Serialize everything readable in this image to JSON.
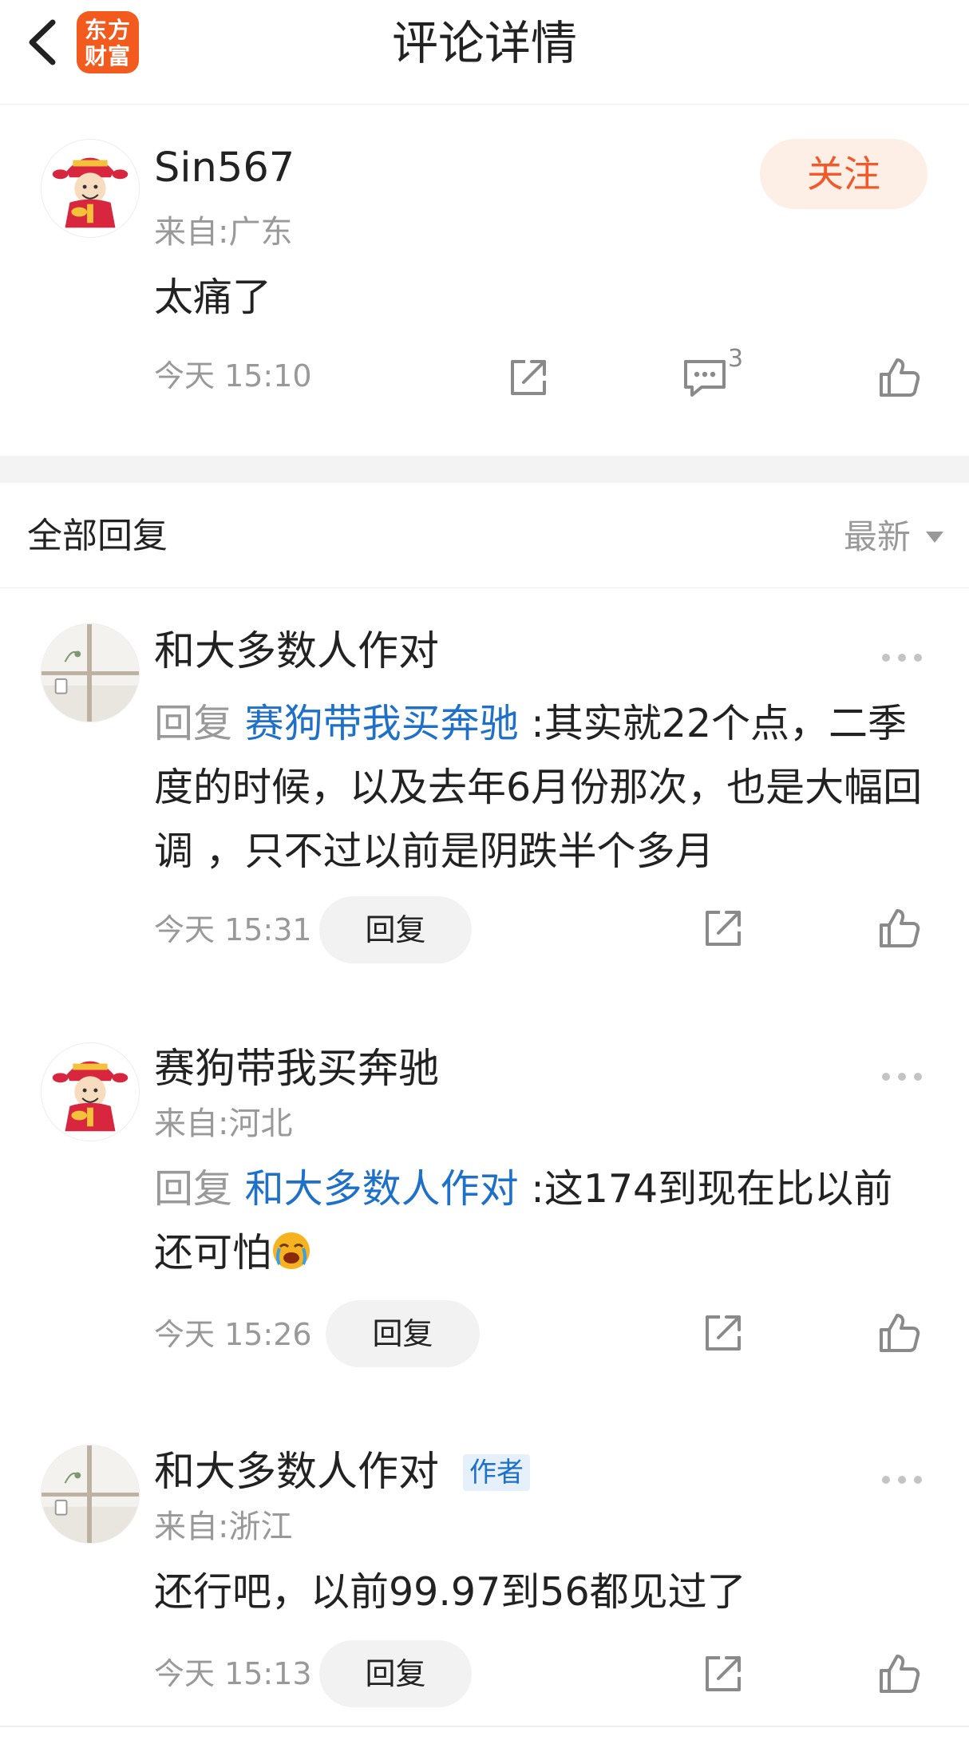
{
  "header": {
    "title": "评论详情",
    "logo_line1": "东方",
    "logo_line2": "财富",
    "icons": {
      "back": "chevron-left-icon"
    }
  },
  "main_comment": {
    "username": "Sin567",
    "location": "来自:广东",
    "text": "太痛了",
    "time": "今天 15:10",
    "follow_label": "关注",
    "reply_count": "3",
    "icons": [
      "share-icon",
      "comment-icon",
      "like-icon"
    ]
  },
  "replies_section": {
    "title": "全部回复",
    "sort_label": "最新"
  },
  "replies": [
    {
      "username": "和大多数人作对",
      "prefix": "回复",
      "target": "赛狗带我买奔驰",
      "text": ":其实就22个点，二季度的时候，以及去年6月份那次，也是大幅回调 ，只不过以前是阴跌半个多月",
      "time": "今天 15:31",
      "reply_label": "回复"
    },
    {
      "username": "赛狗带我买奔驰",
      "location": "来自:河北",
      "prefix": "回复",
      "target": "和大多数人作对",
      "text": ":这174到现在比以前还可怕",
      "emoji": "crying-face-emoji",
      "time": "今天 15:26",
      "reply_label": "回复"
    },
    {
      "username": "和大多数人作对",
      "badge": "作者",
      "location": "来自:浙江",
      "text": "还行吧，以前99.97到56都见过了",
      "time": "今天 15:13",
      "reply_label": "回复"
    }
  ],
  "colors": {
    "accent": "#f0592a",
    "follow_bg": "#fdeee6",
    "link": "#1e70c8",
    "muted": "#999999",
    "logo_bg": "#f25a1e"
  }
}
